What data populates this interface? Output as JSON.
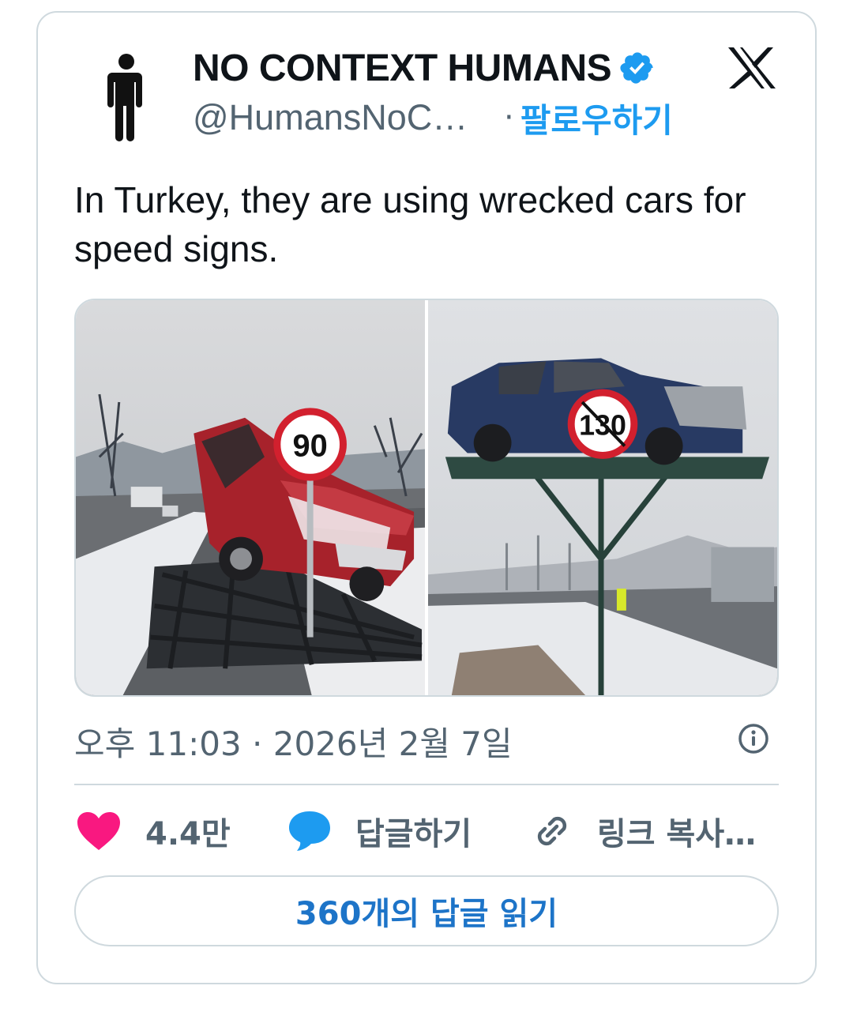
{
  "author": {
    "display_name": "NO CONTEXT HUMANS",
    "handle": "@HumansNoC…",
    "verified": true,
    "avatar_icon": "person-silhouette-icon"
  },
  "header": {
    "separator": "·",
    "follow_label": "팔로우하기",
    "platform_icon": "x-logo-icon"
  },
  "tweet": {
    "text": "In Turkey, they are using wrecked cars for speed signs.",
    "timestamp": "오후 11:03 · 2026년 2월 7일"
  },
  "media": {
    "photos": [
      {
        "description_icon": "photo-wrecked-red-car-speed-sign",
        "sign_value": "90"
      },
      {
        "description_icon": "photo-wrecked-blue-car-speed-sign",
        "sign_value": "130"
      }
    ]
  },
  "actions": {
    "like_count": "4.4만",
    "reply_label": "답글하기",
    "copy_link_label": "링크 복사…"
  },
  "footer": {
    "read_replies_label": "360개의 답글 읽기"
  },
  "colors": {
    "accent_blue": "#1d9bf0",
    "like_pink": "#f91880",
    "text_primary": "#0f1419",
    "text_secondary": "#536471",
    "border": "#cfd9de"
  }
}
